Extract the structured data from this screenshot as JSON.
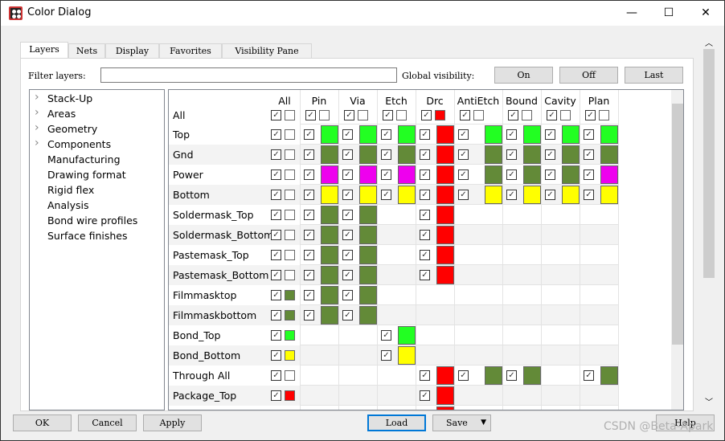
{
  "window": {
    "title": "Color Dialog",
    "minimize": "—",
    "maximize": "☐",
    "close": "✕"
  },
  "tabs": [
    "Layers",
    "Nets",
    "Display",
    "Favorites",
    "Visibility Pane"
  ],
  "filter": {
    "label": "Filter layers:",
    "value": ""
  },
  "global": {
    "label": "Global visibility:",
    "on": "On",
    "off": "Off",
    "last": "Last"
  },
  "tree": [
    {
      "label": "Stack-Up",
      "expandable": true
    },
    {
      "label": "Areas",
      "expandable": true
    },
    {
      "label": "Geometry",
      "expandable": true
    },
    {
      "label": "Components",
      "expandable": true
    },
    {
      "label": "Manufacturing",
      "expandable": false
    },
    {
      "label": "Drawing format",
      "expandable": false
    },
    {
      "label": "Rigid flex",
      "expandable": false
    },
    {
      "label": "Analysis",
      "expandable": false
    },
    {
      "label": "Bond wire profiles",
      "expandable": false
    },
    {
      "label": "Surface finishes",
      "expandable": false
    }
  ],
  "colors": {
    "green": "#22ff22",
    "olive": "#638a38",
    "magenta": "#ee00ee",
    "yellow": "#ffff00",
    "red": "#ff0000",
    "none": "#ffffff"
  },
  "grid": {
    "all_header": "All",
    "columns": [
      "Pin",
      "Via",
      "Etch",
      "Drc",
      "AntiEtch",
      "Bound",
      "Cavity",
      "Plan"
    ],
    "rows": [
      {
        "name": "All",
        "all": "none",
        "cells": [
          "none",
          "none",
          "none",
          "red",
          "none",
          "none",
          "none",
          "none"
        ]
      },
      {
        "name": "Top",
        "all": "none",
        "cells": [
          "green",
          "green",
          "green",
          "red",
          "green",
          "green",
          "green",
          "green"
        ]
      },
      {
        "name": "Gnd",
        "all": "none",
        "cells": [
          "olive",
          "olive",
          "olive",
          "red",
          "olive",
          "olive",
          "olive",
          "olive"
        ]
      },
      {
        "name": "Power",
        "all": "none",
        "cells": [
          "magenta",
          "magenta",
          "magenta",
          "red",
          "olive",
          "olive",
          "olive",
          "magenta"
        ]
      },
      {
        "name": "Bottom",
        "all": "none",
        "cells": [
          "yellow",
          "yellow",
          "yellow",
          "red",
          "yellow",
          "yellow",
          "yellow",
          "yellow"
        ]
      },
      {
        "name": "Soldermask_Top",
        "all": "none",
        "cells": [
          "olive",
          "olive",
          null,
          "red",
          null,
          null,
          null,
          null
        ]
      },
      {
        "name": "Soldermask_Bottom",
        "all": "none",
        "cells": [
          "olive",
          "olive",
          null,
          "red",
          null,
          null,
          null,
          null
        ]
      },
      {
        "name": "Pastemask_Top",
        "all": "none",
        "cells": [
          "olive",
          "olive",
          null,
          "red",
          null,
          null,
          null,
          null
        ]
      },
      {
        "name": "Pastemask_Bottom",
        "all": "none",
        "cells": [
          "olive",
          "olive",
          null,
          "red",
          null,
          null,
          null,
          null
        ]
      },
      {
        "name": "Filmmasktop",
        "all": "olive",
        "cells": [
          "olive",
          "olive",
          null,
          null,
          null,
          null,
          null,
          null
        ]
      },
      {
        "name": "Filmmaskbottom",
        "all": "olive",
        "cells": [
          "olive",
          "olive",
          null,
          null,
          null,
          null,
          null,
          null
        ]
      },
      {
        "name": "Bond_Top",
        "all": "green",
        "cells": [
          null,
          null,
          "green",
          null,
          null,
          null,
          null,
          null
        ]
      },
      {
        "name": "Bond_Bottom",
        "all": "yellow",
        "cells": [
          null,
          null,
          "yellow",
          null,
          null,
          null,
          null,
          null
        ]
      },
      {
        "name": "Through All",
        "all": "none",
        "cells": [
          null,
          null,
          null,
          "red",
          "olive",
          "olive",
          null,
          "olive"
        ]
      },
      {
        "name": "Package_Top",
        "all": "red",
        "cells": [
          null,
          null,
          null,
          "red",
          null,
          null,
          null,
          null
        ]
      },
      {
        "name": "",
        "all": null,
        "cells": [
          null,
          null,
          null,
          "red",
          null,
          null,
          null,
          null
        ]
      }
    ]
  },
  "buttons": {
    "ok": "OK",
    "cancel": "Cancel",
    "apply": "Apply",
    "load": "Load",
    "save": "Save",
    "help": "Help"
  },
  "watermark": "CSDN @Beta-Apark"
}
